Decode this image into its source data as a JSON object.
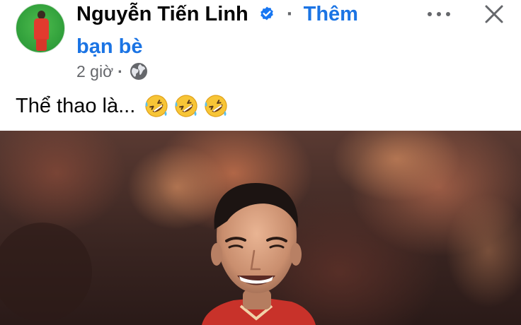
{
  "post": {
    "author_name": "Nguyễn Tiến Linh",
    "add_friend_label_line1": "Thêm",
    "add_friend_label_line2": "bạn bè",
    "separator": "·",
    "time_ago": "2 giờ",
    "privacy_icon": "globe-icon",
    "text": "Thể thao là...",
    "emojis": [
      "rolling-on-floor-laughing",
      "rolling-on-floor-laughing",
      "rolling-on-floor-laughing"
    ]
  },
  "actions": {
    "more_icon": "more-horizontal-icon",
    "close_icon": "close-icon"
  },
  "colors": {
    "link_blue": "#1b74e4",
    "secondary_text": "#65676b",
    "verified_blue": "#1877f2"
  }
}
